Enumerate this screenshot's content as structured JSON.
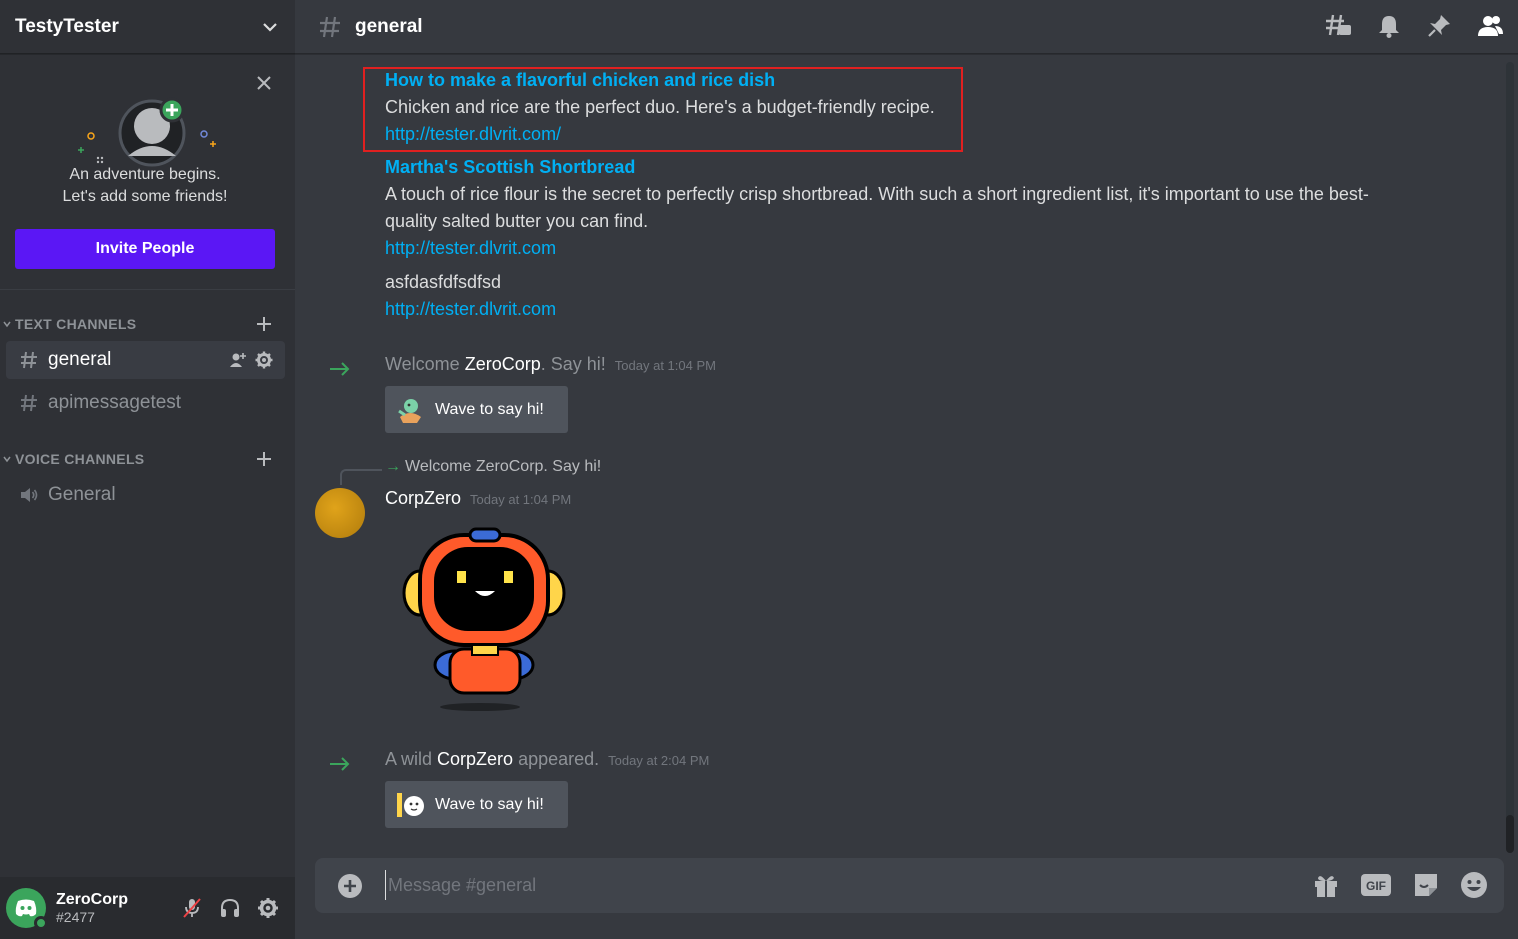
{
  "server": {
    "name": "TestyTester"
  },
  "invite": {
    "line1": "An adventure begins.",
    "line2": "Let's add some friends!",
    "button": "Invite People"
  },
  "categories": {
    "text": "TEXT CHANNELS",
    "voice": "VOICE CHANNELS"
  },
  "channels": {
    "text": [
      {
        "name": "general",
        "active": true
      },
      {
        "name": "apimessagetest",
        "active": false
      }
    ],
    "voice": [
      {
        "name": "General"
      }
    ]
  },
  "user": {
    "name": "ZeroCorp",
    "discriminator": "#2477"
  },
  "header": {
    "channel": "general"
  },
  "messages": {
    "embed1": {
      "title": "How to make a flavorful chicken and rice dish",
      "desc": "Chicken and rice are the perfect duo. Here's a budget-friendly recipe.",
      "url": "http://tester.dlvrit.com/"
    },
    "embed2": {
      "title": "Martha's Scottish Shortbread",
      "desc1": "A touch of rice flour is the secret to perfectly crisp shortbread. With such a short ingredient list, it's important to use the best-",
      "desc2": "quality salted butter you can find.",
      "url": "http://tester.dlvrit.com"
    },
    "plain": {
      "text": "asfdasfdfsdfsd",
      "url": "http://tester.dlvrit.com"
    },
    "welcome1": {
      "pre": "Welcome ",
      "user": "ZeroCorp",
      "post": ". Say hi!",
      "time": "Today at 1:04 PM",
      "wave": "Wave to say hi!"
    },
    "reply": {
      "text": "Welcome ZeroCorp. Say hi!"
    },
    "corp": {
      "author": "CorpZero",
      "time": "Today at 1:04 PM"
    },
    "welcome2": {
      "pre": "A wild ",
      "user": "CorpZero",
      "post": " appeared.",
      "time": "Today at 2:04 PM",
      "wave": "Wave to say hi!"
    }
  },
  "composer": {
    "placeholder": "Message #general"
  },
  "colors": {
    "accent": "#5b17f5",
    "link": "#00b0f4",
    "online": "#3ba55c",
    "highlight_box": "#e02020"
  }
}
